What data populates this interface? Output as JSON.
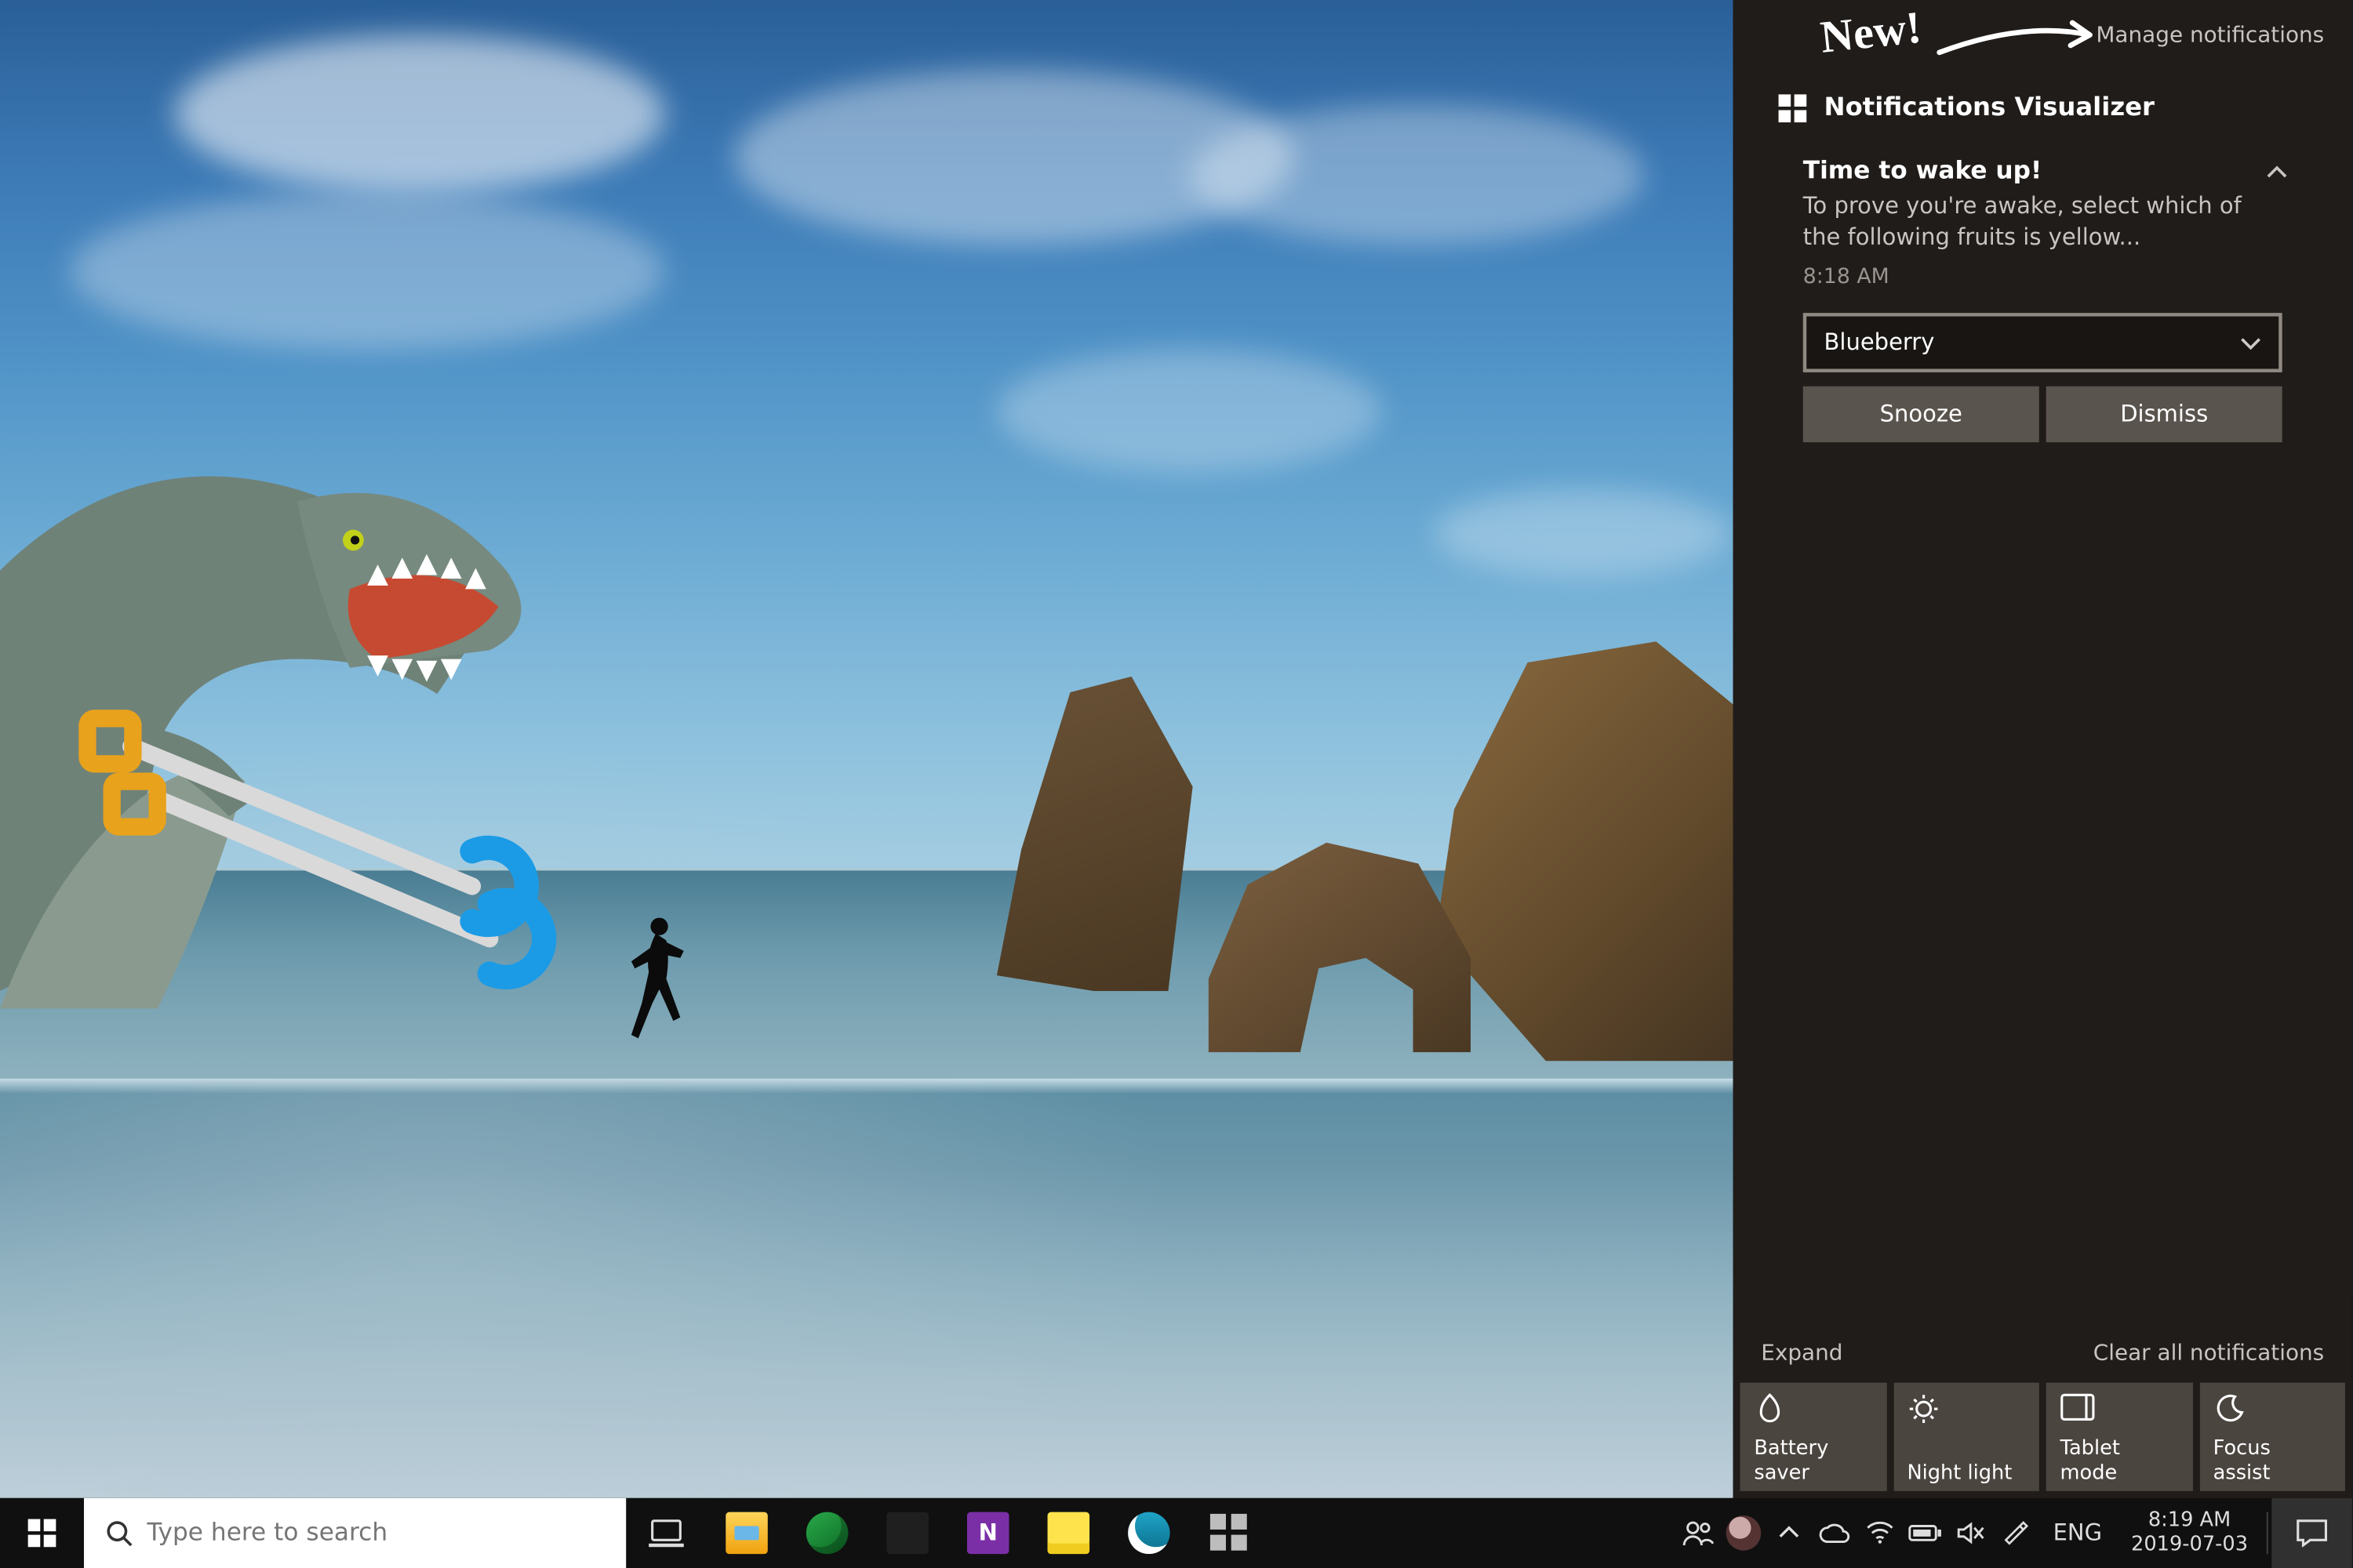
{
  "annotation": {
    "new_label": "New!"
  },
  "action_center": {
    "manage_link": "Manage notifications",
    "app_name": "Notifications Visualizer",
    "notification": {
      "title": "Time to wake up!",
      "body": "To prove you're awake, select which of the following fruits is yellow...",
      "time": "8:18 AM",
      "select_value": "Blueberry",
      "snooze_label": "Snooze",
      "dismiss_label": "Dismiss"
    },
    "footer": {
      "expand": "Expand",
      "clear_all": "Clear all notifications"
    },
    "quick_actions": [
      {
        "label": "Battery saver"
      },
      {
        "label": "Night light"
      },
      {
        "label": "Tablet mode"
      },
      {
        "label": "Focus assist"
      }
    ]
  },
  "taskbar": {
    "search_placeholder": "Type here to search",
    "tray": {
      "language": "ENG",
      "time": "8:19 AM",
      "date": "2019-07-03"
    }
  }
}
